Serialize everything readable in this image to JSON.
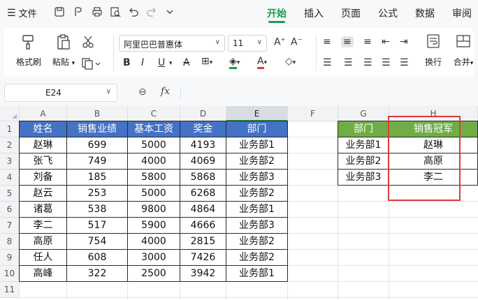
{
  "menu": {
    "file_label": "文件",
    "tabs": [
      {
        "label": "开始",
        "active": true
      },
      {
        "label": "插入",
        "active": false
      },
      {
        "label": "页面",
        "active": false
      },
      {
        "label": "公式",
        "active": false
      },
      {
        "label": "数据",
        "active": false
      },
      {
        "label": "审阅",
        "active": false
      }
    ]
  },
  "ribbon": {
    "format_painter": "格式刷",
    "paste": "粘贴",
    "font_name": "阿里巴巴普惠体",
    "font_size": "11",
    "wrap": "换行",
    "merge": "合并"
  },
  "formula_bar": {
    "cell_ref": "E24",
    "fx": "fx",
    "value": ""
  },
  "sheet": {
    "columns": [
      "A",
      "B",
      "C",
      "D",
      "E",
      "F",
      "G",
      "H"
    ],
    "selected_column": "E",
    "rows": [
      "1",
      "2",
      "3",
      "4",
      "5",
      "6",
      "7",
      "8",
      "9",
      "10",
      "11"
    ],
    "table1": {
      "headers": [
        "姓名",
        "销售业绩",
        "基本工资",
        "奖金",
        "部门"
      ],
      "rows": [
        [
          "赵琳",
          "699",
          "5000",
          "4193",
          "业务部1"
        ],
        [
          "张飞",
          "749",
          "4000",
          "4069",
          "业务部2"
        ],
        [
          "刘备",
          "185",
          "5800",
          "5868",
          "业务部3"
        ],
        [
          "赵云",
          "253",
          "5000",
          "6268",
          "业务部2"
        ],
        [
          "诸葛",
          "538",
          "9800",
          "4864",
          "业务部1"
        ],
        [
          "李二",
          "517",
          "5900",
          "4666",
          "业务部3"
        ],
        [
          "高原",
          "754",
          "4000",
          "2815",
          "业务部2"
        ],
        [
          "任人",
          "608",
          "3000",
          "7426",
          "业务部2"
        ],
        [
          "高峰",
          "322",
          "2500",
          "3942",
          "业务部1"
        ]
      ]
    },
    "table2": {
      "headers": [
        "部门",
        "销售冠军"
      ],
      "rows": [
        [
          "业务部1",
          "赵琳"
        ],
        [
          "业务部2",
          "高原"
        ],
        [
          "业务部3",
          "李二"
        ]
      ]
    }
  },
  "colors": {
    "accent": "#1a9d4a",
    "header_blue": "#4472c4",
    "header_green": "#70ad47",
    "highlight_red": "#e03a3a"
  }
}
